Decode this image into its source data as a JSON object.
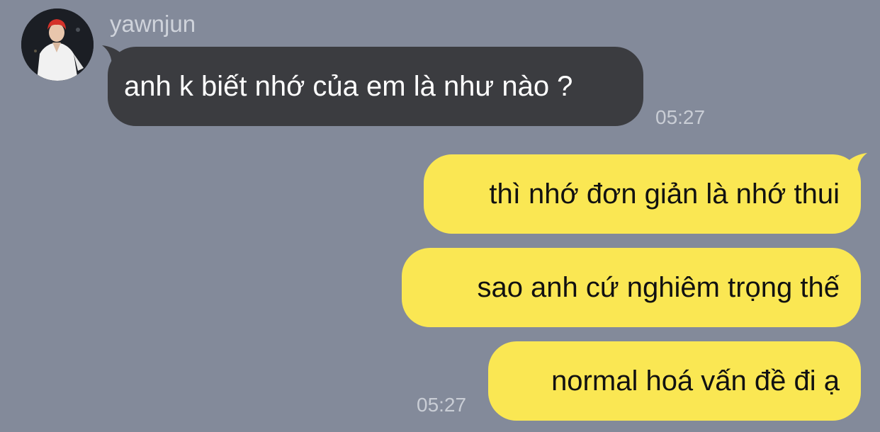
{
  "chat": {
    "sender_name": "yawnjun",
    "incoming": {
      "text": "anh k biết nhớ của em là như nào ?",
      "time": "05:27"
    },
    "outgoing": [
      {
        "text": "thì nhớ đơn giản là nhớ thui"
      },
      {
        "text": "sao anh cứ nghiêm trọng thế"
      },
      {
        "text": "normal hoá vấn đề đi ạ"
      }
    ],
    "outgoing_time": "05:27"
  },
  "colors": {
    "background": "#838a9a",
    "incoming_bubble": "#3b3c40",
    "outgoing_bubble": "#fae753"
  },
  "icons": {
    "avatar": "profile-photo-avatar"
  }
}
